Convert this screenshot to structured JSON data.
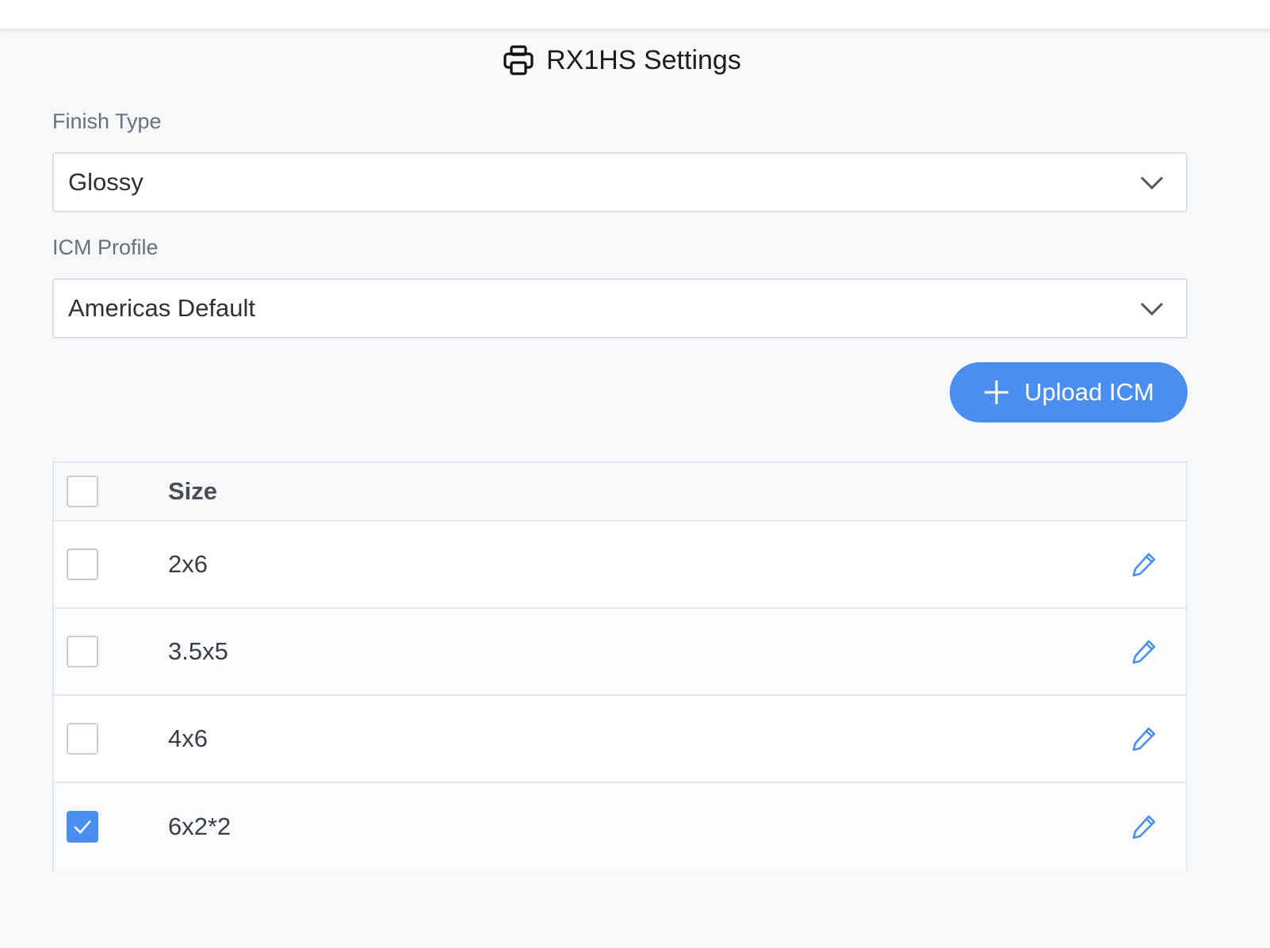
{
  "page": {
    "title": "RX1HS Settings",
    "icon": "printer-icon"
  },
  "finish_type": {
    "label": "Finish Type",
    "value": "Glossy"
  },
  "icm_profile": {
    "label": "ICM Profile",
    "value": "Americas Default"
  },
  "upload_button": {
    "label": "Upload ICM",
    "icon": "plus-icon"
  },
  "colors": {
    "accent": "#4a8ff0",
    "background": "#f7f8fa",
    "border": "#dcdfe6"
  },
  "table": {
    "header": {
      "size_label": "Size",
      "select_all_checked": false
    },
    "rows": [
      {
        "size": "2x6",
        "checked": false
      },
      {
        "size": "3.5x5",
        "checked": false
      },
      {
        "size": "4x6",
        "checked": false
      },
      {
        "size": "6x2*2",
        "checked": true
      }
    ]
  }
}
